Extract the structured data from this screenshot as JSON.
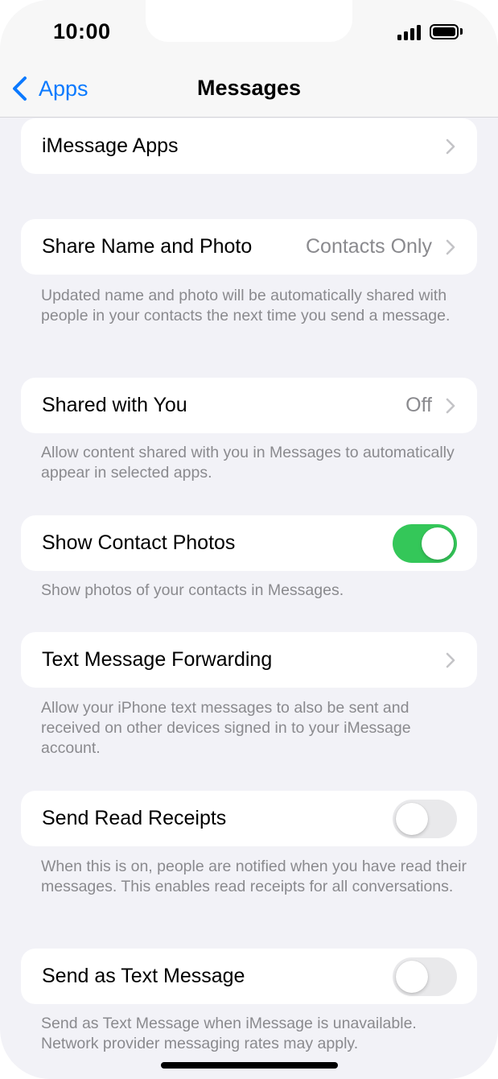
{
  "status_bar": {
    "time": "10:00"
  },
  "nav": {
    "back_label": "Apps",
    "title": "Messages"
  },
  "colors": {
    "accent": "#0a7aff",
    "toggle_on": "#34c759",
    "toggle_off": "#e9e9eb",
    "background": "#f2f2f7"
  },
  "settings": {
    "imessage_apps": {
      "label": "iMessage Apps"
    },
    "share_name_photo": {
      "label": "Share Name and Photo",
      "value": "Contacts Only",
      "footer": "Updated name and photo will be automatically shared with people in your contacts the next time you send a message."
    },
    "shared_with_you": {
      "label": "Shared with You",
      "value": "Off",
      "footer": "Allow content shared with you in Messages to automatically appear in selected apps."
    },
    "show_contact_photos": {
      "label": "Show Contact Photos",
      "enabled": true,
      "footer": "Show photos of your contacts in Messages."
    },
    "text_message_forwarding": {
      "label": "Text Message Forwarding",
      "footer": "Allow your iPhone text messages to also be sent and received on other devices signed in to your iMessage account."
    },
    "send_read_receipts": {
      "label": "Send Read Receipts",
      "enabled": false,
      "footer": "When this is on, people are notified when you have read their messages. This enables read receipts for all conversations."
    },
    "send_as_text_message": {
      "label": "Send as Text Message",
      "enabled": false,
      "footer": "Send as Text Message when iMessage is unavailable. Network provider messaging rates may apply."
    }
  },
  "icons": {
    "back": "chevron-left-icon",
    "disclosure": "chevron-right-icon",
    "signal": "cellular-signal-icon",
    "battery": "battery-icon"
  }
}
